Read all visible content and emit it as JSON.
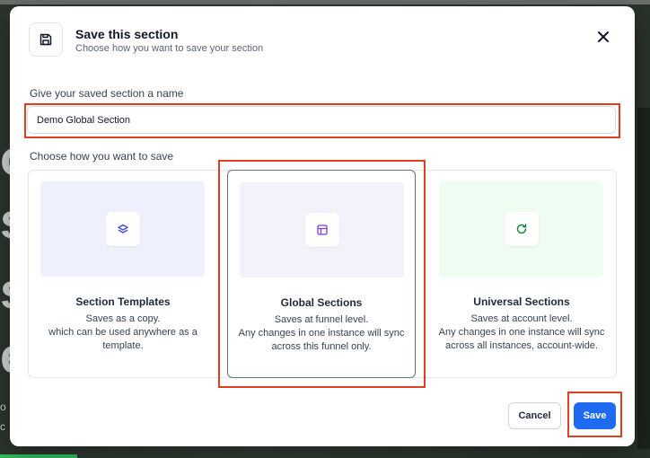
{
  "background": {
    "letters": [
      "o",
      "s",
      "s",
      "e"
    ],
    "small_lines": [
      "o",
      "c"
    ]
  },
  "modal": {
    "title": "Save this section",
    "subtitle": "Choose how you want to save your section",
    "header_icon": "floppy-disk-icon",
    "close_icon": "close-icon",
    "name_field": {
      "label": "Give your saved section a name",
      "value": "Demo Global Section",
      "placeholder": ""
    },
    "options_label": "Choose how you want to save",
    "options": [
      {
        "title": "Section Templates",
        "desc": "Saves as a copy.\nwhich can be used anywhere as a template.",
        "icon": "layers-icon",
        "preview_color": "#eef1fd",
        "icon_color": "#3b3fd8",
        "selected": false
      },
      {
        "title": "Global Sections",
        "desc": "Saves at funnel level.\nAny changes in one instance will sync across this funnel only.",
        "icon": "layout-icon",
        "preview_color": "#f4f1fd",
        "icon_color": "#7a3fd8",
        "selected": true
      },
      {
        "title": "Universal Sections",
        "desc": "Saves at account level.\nAny changes in one instance will sync across all instances, account-wide.",
        "icon": "refresh-icon",
        "preview_color": "#eefcf1",
        "icon_color": "#15803d",
        "selected": false
      }
    ],
    "cancel_label": "Cancel",
    "save_label": "Save"
  },
  "colors": {
    "primary": "#1e6bf2",
    "highlight": "#e0401f"
  }
}
